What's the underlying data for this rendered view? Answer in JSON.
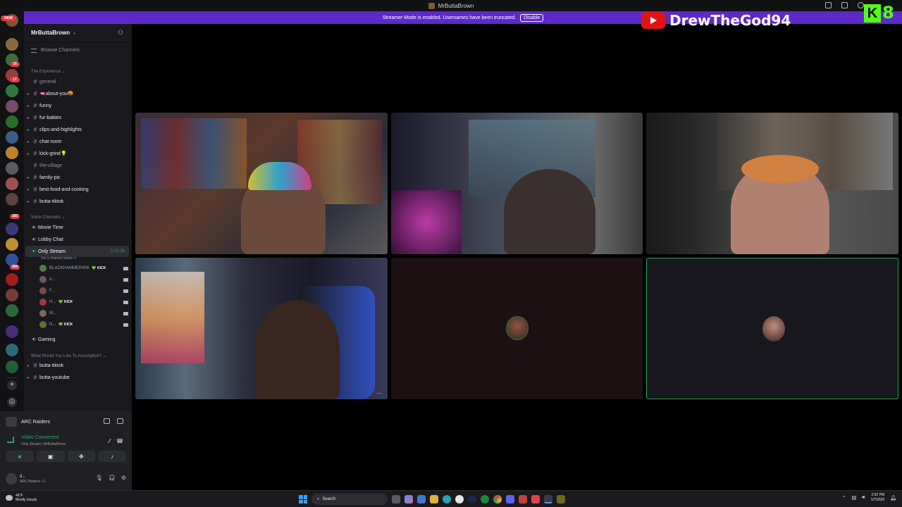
{
  "window": {
    "title": "MrButtaBrown"
  },
  "banner": {
    "text": "Streamer Mode is enabled. Usernames have been truncated.",
    "button": "Disable"
  },
  "rail": {
    "new_badge": "NEW",
    "badges": [
      "16",
      "17",
      "183",
      "406"
    ]
  },
  "server": {
    "name": "MrButtaBrown",
    "browse": "Browse Channels",
    "categories": {
      "experience": "The Experience",
      "voice": "Voice Channels",
      "accomplish": "What Would You Like To Accomplish?"
    },
    "text_channels": [
      {
        "name": "general",
        "dim": true
      },
      {
        "name": "🫦about-you🤬",
        "dim": false
      },
      {
        "name": "funny",
        "dim": false
      },
      {
        "name": "fur-babies",
        "dim": false
      },
      {
        "name": "clips-and-highlights",
        "dim": false
      },
      {
        "name": "chat-room",
        "dim": false
      },
      {
        "name": "kick-grind💡",
        "dim": false
      },
      {
        "name": "the-village",
        "dim": true
      },
      {
        "name": "family-pic",
        "dim": false
      },
      {
        "name": "best-food-and-cooking",
        "dim": false
      },
      {
        "name": "butta-tiktok",
        "dim": false
      }
    ],
    "voice_channels": [
      {
        "name": "Movie Time"
      },
      {
        "name": "Lobby Chat"
      },
      {
        "name": "Only Stream",
        "timer": "2:21:36",
        "status": "Set a channel status ✏"
      },
      {
        "name": "Gaming"
      }
    ],
    "voice_users": [
      {
        "name": "BLACKHAMMER406",
        "kick": "💚 KICK",
        "cam": true
      },
      {
        "name": "d...",
        "kick": "",
        "cam": true
      },
      {
        "name": "F...",
        "kick": "",
        "cam": true
      },
      {
        "name": "H...",
        "kick": "💚 KICK",
        "cam": true
      },
      {
        "name": "M...",
        "kick": "",
        "cam": true
      },
      {
        "name": "N...",
        "kick": "💚 KICK",
        "cam": true
      }
    ],
    "bottom_channels": [
      {
        "name": "butta-tiktok"
      },
      {
        "name": "butta-youtube"
      }
    ]
  },
  "voice_panel": {
    "game": "ARC Raiders",
    "status": "Video Connected",
    "location": "Only Stream / MrButtaBrown",
    "user_name": "d...",
    "user_sub": "ARC Raiders +1"
  },
  "overlay": {
    "youtube_name": "DrewTheGod94",
    "kick_logo": "K",
    "kick_count": "8"
  },
  "taskbar": {
    "temp": "46°F",
    "weather": "Mostly cloudy",
    "search": "Search",
    "time": "2:52 PM",
    "date": "1/7/2026"
  },
  "colors": {
    "brand_purple": "#5e29c9",
    "voice_green": "#23a55a",
    "kick_green": "#53fc18",
    "youtube_red": "#e11414"
  }
}
